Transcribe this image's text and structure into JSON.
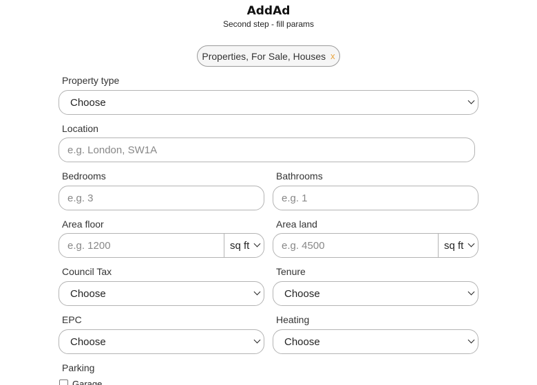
{
  "header": {
    "title": "AddAd",
    "subtitle": "Second step - fill params"
  },
  "category_chip": {
    "label": "Properties, For Sale, Houses",
    "remove": "x"
  },
  "form": {
    "property_type": {
      "label": "Property type",
      "value": "Choose"
    },
    "location": {
      "label": "Location",
      "placeholder": "e.g. London, SW1A"
    },
    "bedrooms": {
      "label": "Bedrooms",
      "placeholder": "e.g. 3"
    },
    "bathrooms": {
      "label": "Bathrooms",
      "placeholder": "e.g. 1"
    },
    "area_floor": {
      "label": "Area floor",
      "placeholder": "e.g. 1200",
      "unit": "sq ft"
    },
    "area_land": {
      "label": "Area land",
      "placeholder": "e.g. 4500",
      "unit": "sq ft"
    },
    "council_tax": {
      "label": "Council Tax",
      "value": "Choose"
    },
    "tenure": {
      "label": "Tenure",
      "value": "Choose"
    },
    "epc": {
      "label": "EPC",
      "value": "Choose"
    },
    "heating": {
      "label": "Heating",
      "value": "Choose"
    },
    "parking": {
      "label": "Parking",
      "options": [
        "Garage"
      ]
    }
  }
}
